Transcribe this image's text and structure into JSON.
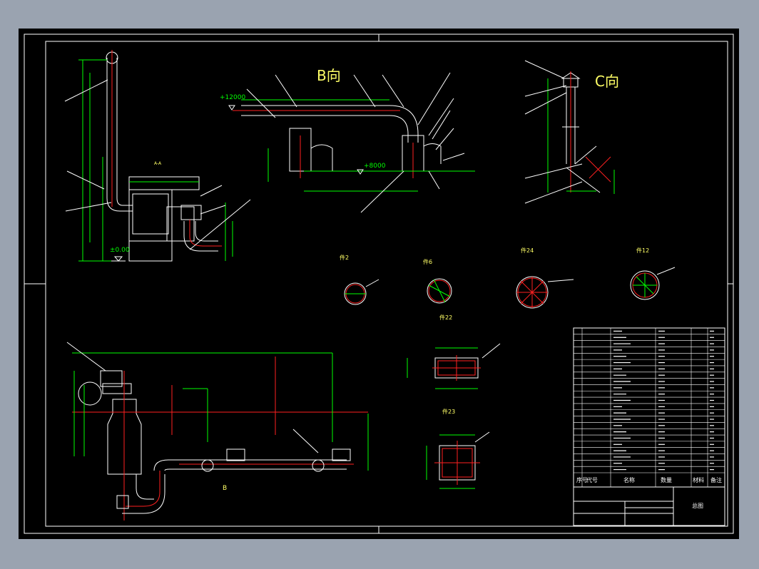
{
  "views": {
    "b_view": "B向",
    "c_view": "C向",
    "section_aa": "A-A",
    "section_b": "B"
  },
  "elevations": {
    "top": "+12000",
    "mid": "+8000",
    "ground": "±0.00"
  },
  "parts": {
    "p2": "件2",
    "p6": "件6",
    "p24": "件24",
    "p12": "件12",
    "p22": "件22",
    "p23": "件23"
  },
  "title_block": {
    "drawing_name": "总图",
    "header": [
      "序号",
      "代号",
      "名称",
      "数量",
      "材料",
      "备注"
    ]
  },
  "colors": {
    "background": "#000000",
    "frame": "#ffffff",
    "dimension": "#00ff00",
    "centerline": "#ff2020",
    "outline": "#ffffff",
    "annotation": "#ffff00"
  }
}
